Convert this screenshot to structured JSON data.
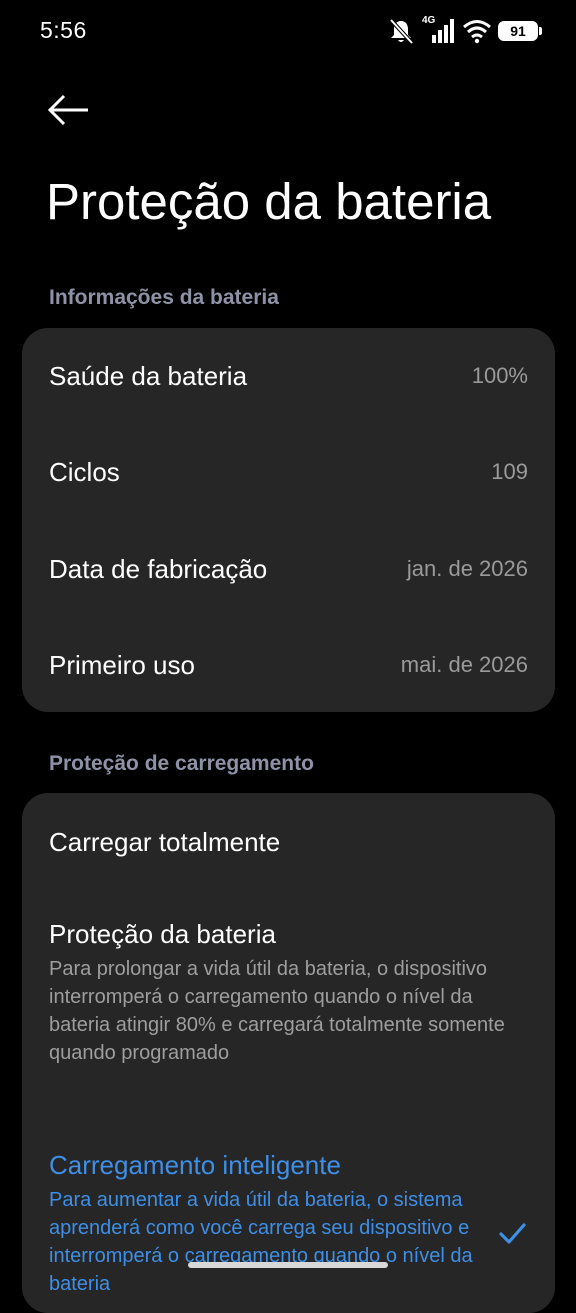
{
  "status_bar": {
    "time": "5:56",
    "network": "4G",
    "battery_level": "91"
  },
  "header": {
    "title": "Proteção da bateria"
  },
  "battery_info": {
    "section_label": "Informações da bateria",
    "rows": [
      {
        "label": "Saúde da bateria",
        "value": "100%"
      },
      {
        "label": "Ciclos",
        "value": "109"
      },
      {
        "label": "Data de fabricação",
        "value": "jan. de 2026"
      },
      {
        "label": "Primeiro uso",
        "value": "mai. de 2026"
      }
    ]
  },
  "charging_protection": {
    "section_label": "Proteção de carregamento",
    "options": [
      {
        "title": "Carregar totalmente",
        "description": "",
        "selected": false
      },
      {
        "title": "Proteção da bateria",
        "description": "Para prolongar a vida útil da bateria, o dispositivo interromperá o carregamento quando o nível da bateria atingir 80% e carregará totalmente somente quando programado",
        "selected": false
      },
      {
        "title": "Carregamento inteligente",
        "description": "Para aumentar a vida útil da bateria, o sistema aprenderá como você carrega seu dispositivo e interromperá o carregamento quando o nível da bateria",
        "selected": true
      }
    ]
  },
  "colors": {
    "background": "#000000",
    "card": "#262626",
    "accent": "#3d8fe8",
    "section_label": "#8e92a6",
    "secondary_text": "#9e9e9e"
  }
}
